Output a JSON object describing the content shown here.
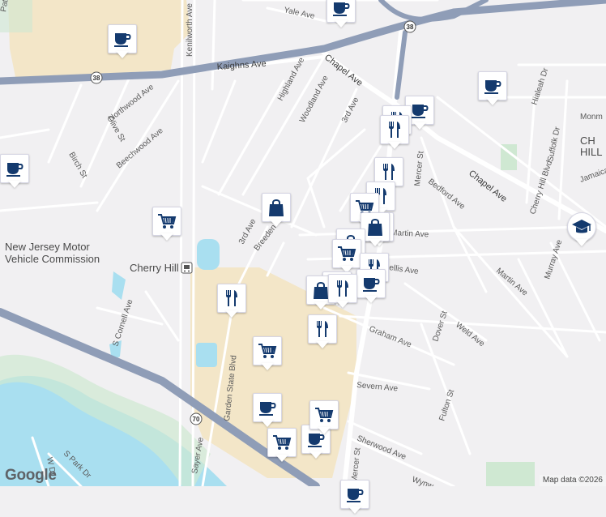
{
  "colors": {
    "background": "#f1f0f2",
    "park": "#cfe8d2",
    "water": "#a9dff0",
    "highway": "#8f9db7",
    "road": "#ffffff",
    "lot": "#f3e6c8",
    "pin_icon": "#143a6e"
  },
  "streets": {
    "yale": "Yale Ave",
    "kenilworth": "Kenilworth Ave",
    "kaighns": "Kaighns Ave",
    "highland": "Highland Ave",
    "chapel_n": "Chapel Ave",
    "northwood": "Northwood Ave",
    "woodland": "Woodland Ave",
    "third_n": "3rd Ave",
    "olive": "Olive St",
    "beechwood": "Beechwood Ave",
    "birch": "Birch St",
    "mercer": "Mercer St",
    "bedford": "Bedford Ave",
    "chapel_e": "Chapel Ave",
    "hialeah": "Hialeah Dr",
    "suffolk": "Suffolk Dr",
    "cherry_hill_blvd": "Cherry Hill Blvd",
    "jamaica": "Jamaica",
    "monm": "Monm",
    "breeden": "Breeden Dr",
    "third_s": "3rd Ave",
    "martin": "Martin Ave",
    "murray": "Murray Ave",
    "ellis": "ellis Ave",
    "martin_s": "Martin Ave",
    "s_cornell": "S Cornell Ave",
    "dover": "Dover St",
    "weld": "Weld Ave",
    "graham": "Graham Ave",
    "garden_state": "Garden State Blvd",
    "severn": "Severn Ave",
    "fulton": "Fulton St",
    "sherwood": "Sherwood Ave",
    "sayer": "Sayer Ave",
    "s_park": "S Park Dr",
    "w_dr": "W Dr",
    "mercer_s": "Mercer St",
    "wynw": "Wynw",
    "pat": "Pat"
  },
  "places": {
    "nj_motor_1": "New Jersey Motor",
    "nj_motor_2": "Vehicle Commission",
    "cherry_hill": "Cherry Hill",
    "chill_1": "CH",
    "chill_2": "HILL"
  },
  "shields": {
    "route_38_a": "38",
    "route_38_b": "38",
    "route_70": "70"
  },
  "pins": [
    {
      "type": "cafe-icon"
    },
    {
      "type": "cafe-icon"
    },
    {
      "type": "cafe-icon"
    },
    {
      "type": "cafe-icon"
    },
    {
      "type": "cafe-icon"
    },
    {
      "type": "restaurant-icon"
    },
    {
      "type": "restaurant-icon"
    },
    {
      "type": "restaurant-icon"
    },
    {
      "type": "restaurant-icon"
    },
    {
      "type": "shopping-bag-icon"
    },
    {
      "type": "grocery-cart-icon"
    },
    {
      "type": "grocery-cart-icon"
    },
    {
      "type": "grocery-cart-icon"
    },
    {
      "type": "shopping-bag-icon"
    },
    {
      "type": "shopping-bag-icon"
    },
    {
      "type": "grocery-cart-icon"
    },
    {
      "type": "restaurant-icon"
    },
    {
      "type": "cafe-icon"
    },
    {
      "type": "restaurant-icon"
    },
    {
      "type": "shopping-bag-icon"
    },
    {
      "type": "restaurant-icon"
    },
    {
      "type": "restaurant-icon"
    },
    {
      "type": "restaurant-icon"
    },
    {
      "type": "grocery-cart-icon"
    },
    {
      "type": "cafe-icon"
    },
    {
      "type": "cafe-icon"
    },
    {
      "type": "grocery-cart-icon"
    },
    {
      "type": "grocery-cart-icon"
    },
    {
      "type": "cafe-icon"
    },
    {
      "type": "school-icon"
    },
    {
      "type": "cafe-icon"
    }
  ],
  "footer": {
    "logo": "Google",
    "attribution": "Map data ©2026"
  }
}
